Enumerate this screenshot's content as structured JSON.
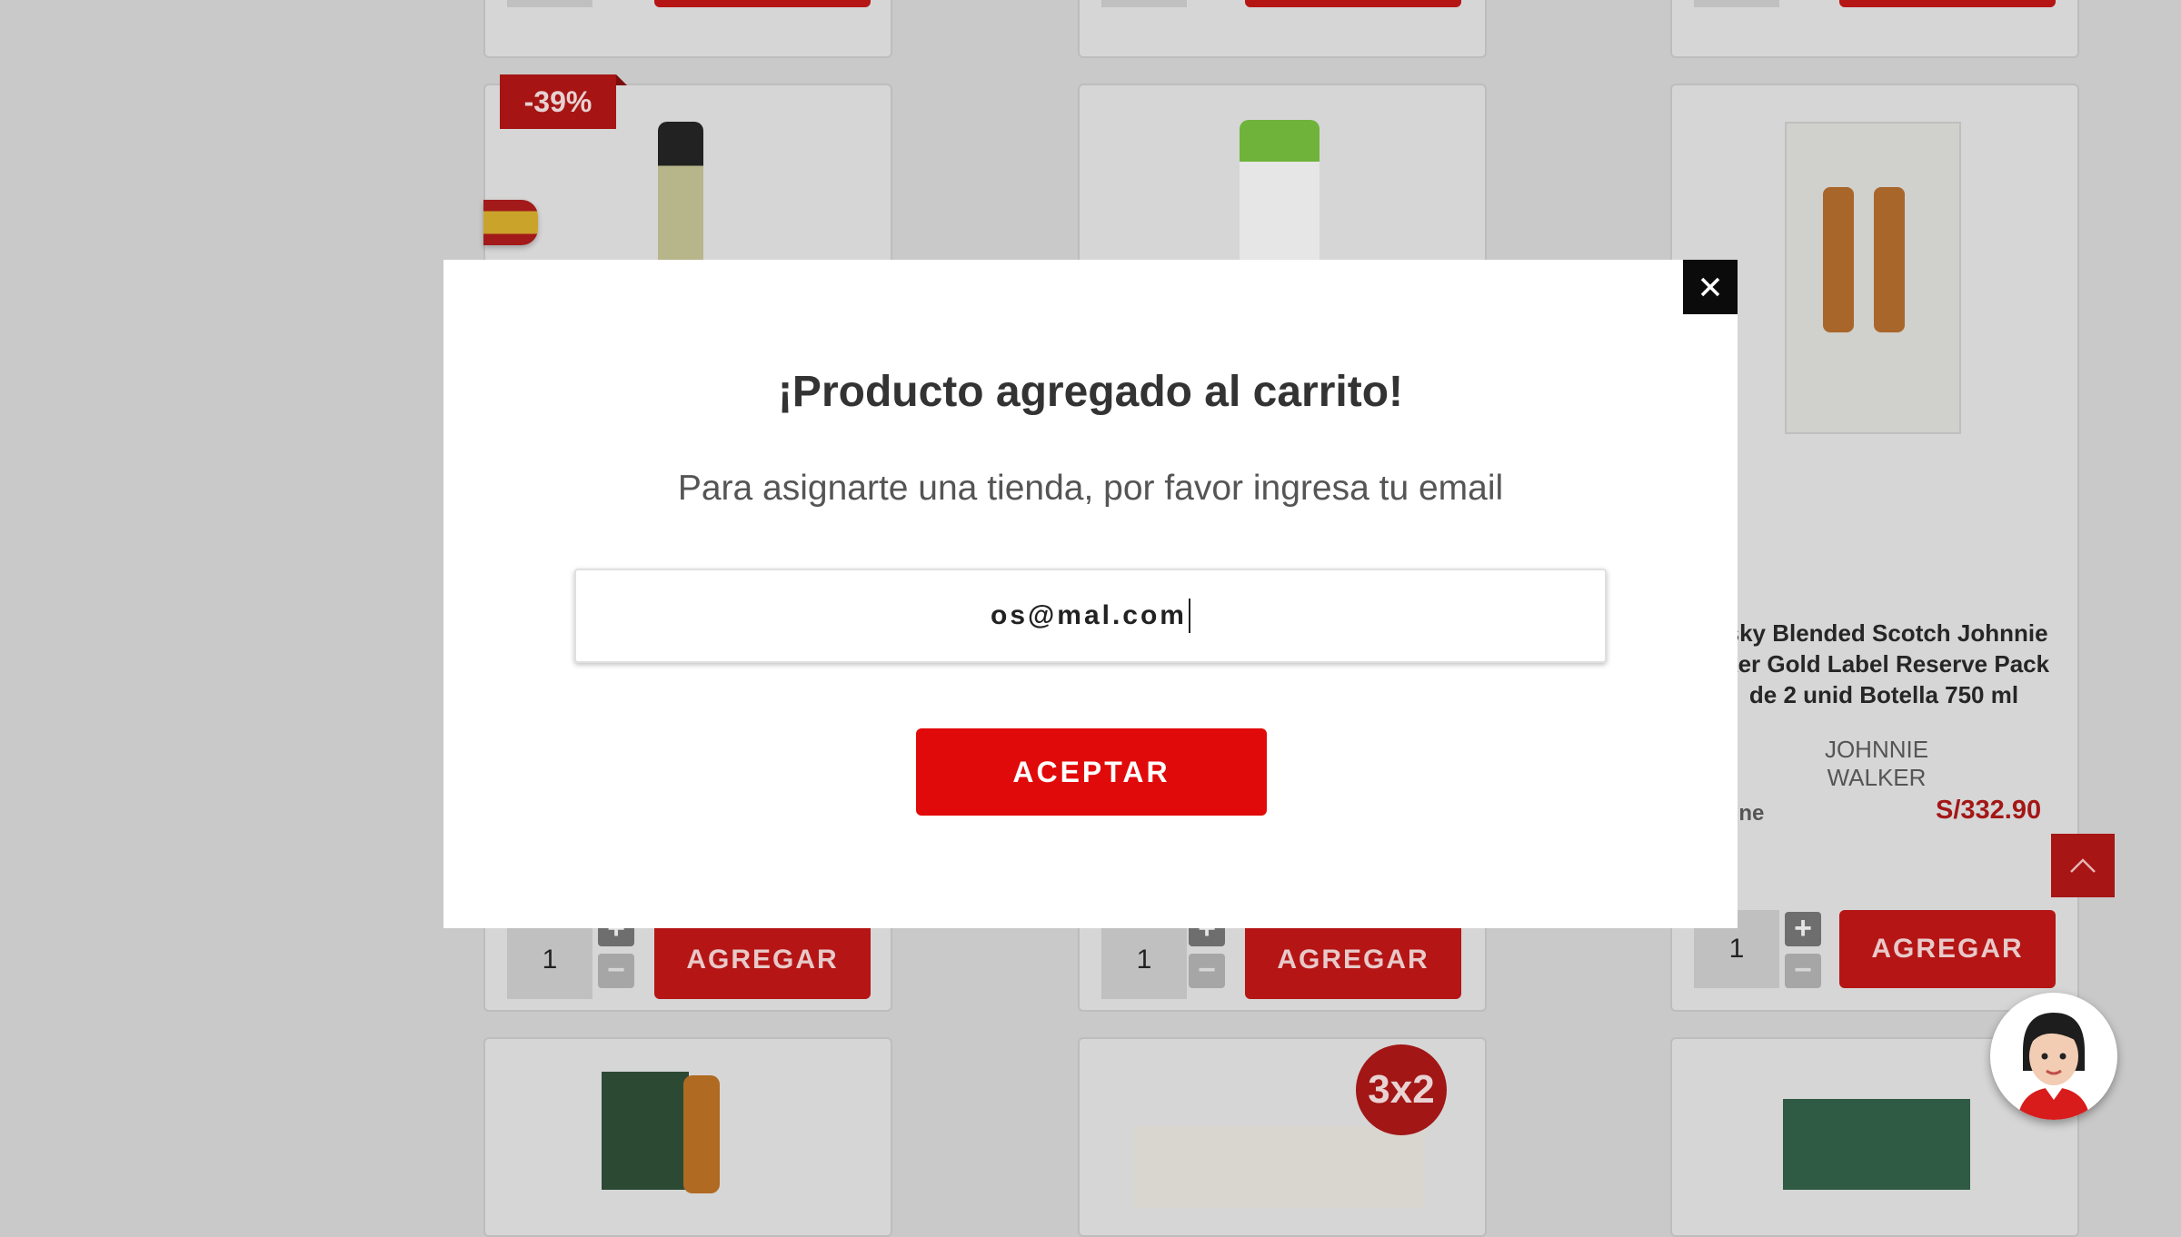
{
  "products": {
    "quantity": "1",
    "add_label": "AGREGAR",
    "discount_badge": "-39%",
    "promo_badge": "3x2",
    "visible_product": {
      "title_line1": "isky Blended Scotch Johnnie",
      "title_line2": "lker Gold Label Reserve Pack",
      "title_line3": "de 2 unid Botella 750 ml",
      "brand": "JOHNNIE WALKER",
      "availability": "line",
      "price": "S/332.90"
    }
  },
  "modal": {
    "title": "¡Producto agregado al carrito!",
    "subtitle": "Para asignarte una tienda, por favor ingresa tu email",
    "email_value": "os@mal.com",
    "accept_label": "ACEPTAR"
  },
  "colors": {
    "accent_red": "#e10a0a",
    "price_red": "#a31717"
  },
  "icons": [
    "close-icon",
    "chevron-up-icon",
    "plus-icon",
    "minus-icon",
    "flag-spain-icon",
    "assistant-avatar-icon"
  ]
}
